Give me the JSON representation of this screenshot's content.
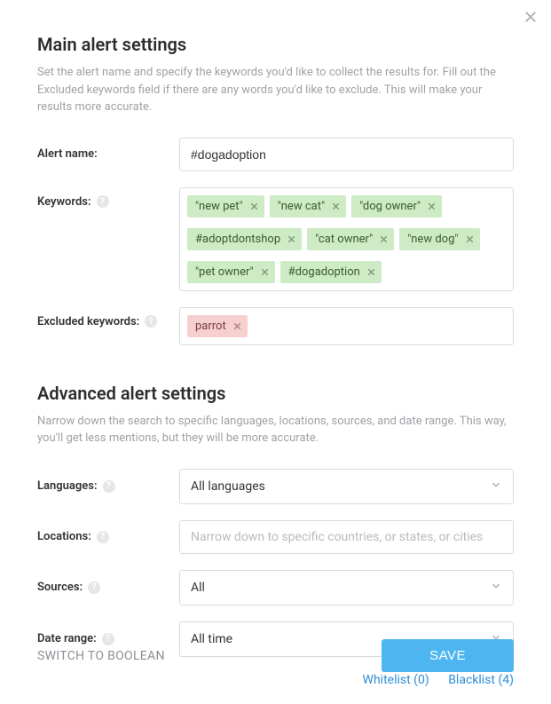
{
  "main": {
    "title": "Main alert settings",
    "description": "Set the alert name and specify the keywords you'd like to collect the results for. Fill out the Excluded keywords field if there are any words you'd like to exclude. This will make your results more accurate.",
    "alertName": {
      "label": "Alert name:",
      "value": "#dogadoption"
    },
    "keywords": {
      "label": "Keywords:",
      "tags": [
        "\"new pet\"",
        "\"new cat\"",
        "\"dog owner\"",
        "#adoptdontshop",
        "\"cat owner\"",
        "\"new dog\"",
        "\"pet owner\"",
        "#dogadoption"
      ]
    },
    "excluded": {
      "label": "Excluded keywords:",
      "tags": [
        "parrot"
      ]
    }
  },
  "advanced": {
    "title": "Advanced alert settings",
    "description": "Narrow down the search to specific languages, locations, sources, and date range. This way, you'll get less mentions, but they will be more accurate.",
    "languages": {
      "label": "Languages:",
      "value": "All languages"
    },
    "locations": {
      "label": "Locations:",
      "placeholder": "Narrow down to specific countries, or states, or cities"
    },
    "sources": {
      "label": "Sources:",
      "value": "All"
    },
    "dateRange": {
      "label": "Date range:",
      "value": "All time"
    },
    "whitelist": {
      "label": "Whitelist",
      "count": 0
    },
    "blacklist": {
      "label": "Blacklist",
      "count": 4
    }
  },
  "footer": {
    "switch": "SWITCH TO BOOLEAN",
    "save": "SAVE"
  },
  "helpGlyph": "?"
}
